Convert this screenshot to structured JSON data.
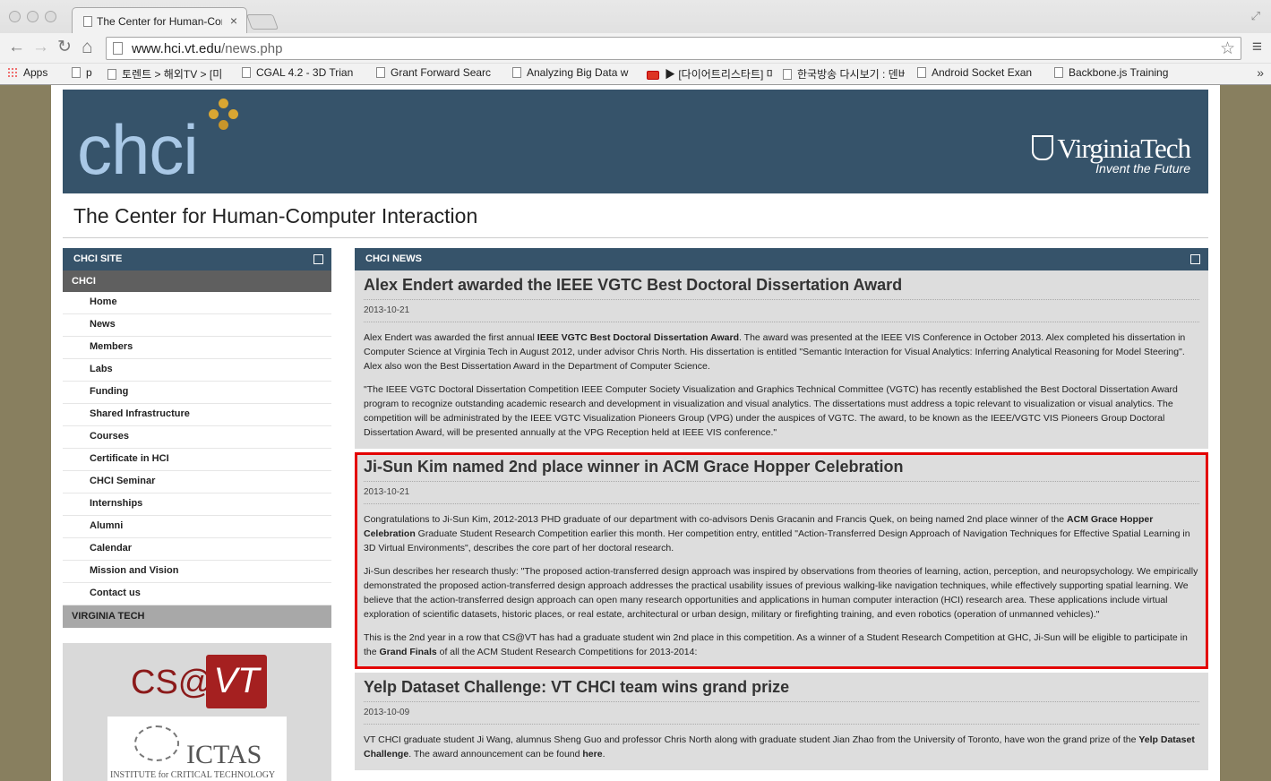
{
  "browser": {
    "tab_title": "The Center for Human-Computer Interaction",
    "tab_close": "×",
    "url_host": "www.hci.vt.edu",
    "url_path": "/news.php",
    "back": "←",
    "forward": "→",
    "reload": "↻",
    "home": "⌂",
    "star": "☆",
    "menu": "≡",
    "resize": "⤢",
    "bookmarks_more": "»",
    "bookmarks": [
      {
        "label": "Apps",
        "icon": "apps-icon"
      },
      {
        "label": "p",
        "icon": "page-icon"
      },
      {
        "label": "토렌트 > 해외TV > [미",
        "icon": "page-icon"
      },
      {
        "label": "CGAL 4.2 - 3D Trian",
        "icon": "page-icon"
      },
      {
        "label": "Grant Forward Searc",
        "icon": "page-icon"
      },
      {
        "label": "Analyzing Big Data w",
        "icon": "page-icon"
      },
      {
        "label": "▶ [다이어트리스타트] 마",
        "icon": "youtube-icon"
      },
      {
        "label": "한국방송 다시보기 : 덴버",
        "icon": "page-icon"
      },
      {
        "label": "Android Socket Exan",
        "icon": "gear-icon"
      },
      {
        "label": "Backbone.js Training",
        "icon": "page-icon"
      }
    ]
  },
  "header": {
    "logo_text": "chci",
    "vt_name": "VirginiaTech",
    "vt_tagline": "Invent the Future",
    "site_title": "The Center for Human-Computer Interaction"
  },
  "sidebar": {
    "heading": "CHCI SITE",
    "section": "CHCI",
    "items": [
      "Home",
      "News",
      "Members",
      "Labs",
      "Funding",
      "Shared Infrastructure",
      "Courses",
      "Certificate in HCI",
      "CHCI Seminar",
      "Internships",
      "Alumni",
      "Calendar",
      "Mission and Vision",
      "Contact us"
    ],
    "section2": "VIRGINIA TECH",
    "csvt_cs": "CS@",
    "csvt_vt": "VT",
    "ictas_name": "ICTAS",
    "ictas_sub": "INSTITUTE for CRITICAL TECHNOLOGY"
  },
  "news": {
    "heading": "CHCI NEWS",
    "articles": [
      {
        "title": "Alex Endert awarded the IEEE VGTC Best Doctoral Dissertation Award",
        "date": "2013-10-21",
        "p1_a": "Alex Endert was awarded the first annual ",
        "p1_b": "IEEE VGTC Best Doctoral Dissertation Award",
        "p1_c": ". The award was presented at the IEEE VIS Conference in October 2013. Alex completed his dissertation in Computer Science at Virginia Tech in August 2012, under advisor Chris North. His dissertation is entitled \"Semantic Interaction for Visual Analytics: Inferring Analytical Reasoning for Model Steering\". Alex also won the Best Dissertation Award in the Department of Computer Science.",
        "p2": "\"The IEEE VGTC Doctoral Dissertation Competition IEEE Computer Society Visualization and Graphics Technical Committee (VGTC) has recently established the Best Doctoral Dissertation Award program to recognize outstanding academic research and development in visualization and visual analytics. The dissertations must address a topic relevant to visualization or visual analytics. The competition will be administrated by the IEEE VGTC Visualization Pioneers Group (VPG) under the auspices of VGTC. The award, to be known as the IEEE/VGTC VIS Pioneers Group Doctoral Dissertation Award, will be presented annually at the VPG Reception held at IEEE VIS conference.\""
      },
      {
        "title": "Ji-Sun Kim named 2nd place winner in ACM Grace Hopper Celebration",
        "date": "2013-10-21",
        "p1_a": "Congratulations to Ji-Sun Kim, 2012-2013 PHD graduate of our department with co-advisors Denis Gracanin and Francis Quek, on being named 2nd place winner of the ",
        "p1_b": "ACM Grace Hopper Celebration",
        "p1_c": " Graduate Student Research Competition earlier this month. Her competition entry, entitled \"Action-Transferred Design Approach of Navigation Techniques for Effective Spatial Learning in 3D Virtual Environments\", describes the core part of her doctoral research.",
        "p2": "Ji-Sun describes her research thusly: \"The proposed action-transferred design approach was inspired by observations from theories of learning, action, perception, and neuropsychology. We empirically demonstrated the proposed action-transferred design approach addresses the practical usability issues of previous walking-like navigation techniques, while effectively supporting spatial learning. We believe that the action-transferred design approach can open many research opportunities and applications in human computer interaction (HCI) research area. These applications include virtual exploration of scientific datasets, historic places, or real estate, architectural or urban design, military or firefighting training, and even robotics (operation of unmanned vehicles).\"",
        "p3_a": "This is the 2nd year in a row that CS@VT has had a graduate student win 2nd place in this competition. As a winner of a Student Research Competition at GHC, Ji-Sun will be eligible to participate in the ",
        "p3_b": "Grand Finals",
        "p3_c": " of all the ACM Student Research Competitions for 2013-2014:"
      },
      {
        "title": "Yelp Dataset Challenge: VT CHCI team wins grand prize",
        "date": "2013-10-09",
        "p1_a": "VT CHCI graduate student Ji Wang, alumnus Sheng Guo and professor Chris North along with graduate student Jian Zhao from the University of Toronto, have won the grand prize of the ",
        "p1_b": "Yelp Dataset Challenge",
        "p1_c": ". The award announcement can be found ",
        "p1_d": "here",
        "p1_e": "."
      }
    ]
  },
  "colors": {
    "banner": "#36536a",
    "highlight": "#e30000",
    "backdrop": "#887f5f"
  }
}
